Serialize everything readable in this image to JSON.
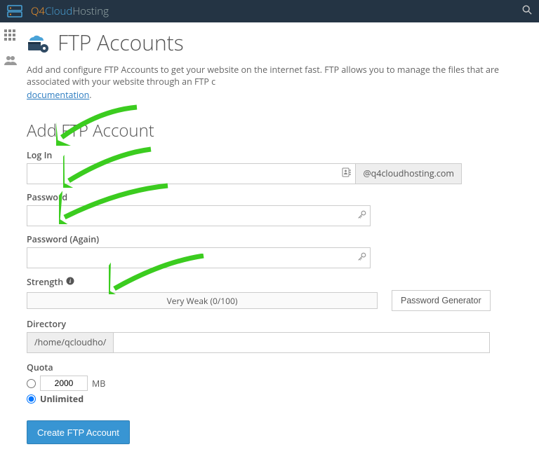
{
  "brand": {
    "q4": "Q4",
    "cloud": "Cloud",
    "hosting": "Hosting"
  },
  "page": {
    "title": "FTP Accounts",
    "intro_prefix": "Add and configure FTP Accounts to get your website on the internet fast. FTP allows you to manage the files that are associated with your website through an FTP c",
    "doc_link": "documentation",
    "intro_suffix": "."
  },
  "form": {
    "section_title": "Add FTP Account",
    "login_label": "Log In",
    "login_domain": "@q4cloudhosting.com",
    "password_label": "Password",
    "password_again_label": "Password (Again)",
    "strength_label": "Strength",
    "strength_text": "Very Weak (0/100)",
    "pw_gen": "Password Generator",
    "directory_label": "Directory",
    "directory_prefix": "/home/qcloudho/",
    "quota_label": "Quota",
    "quota_value": "2000",
    "quota_unit": "MB",
    "quota_unlimited": "Unlimited",
    "create_btn": "Create FTP Account"
  }
}
